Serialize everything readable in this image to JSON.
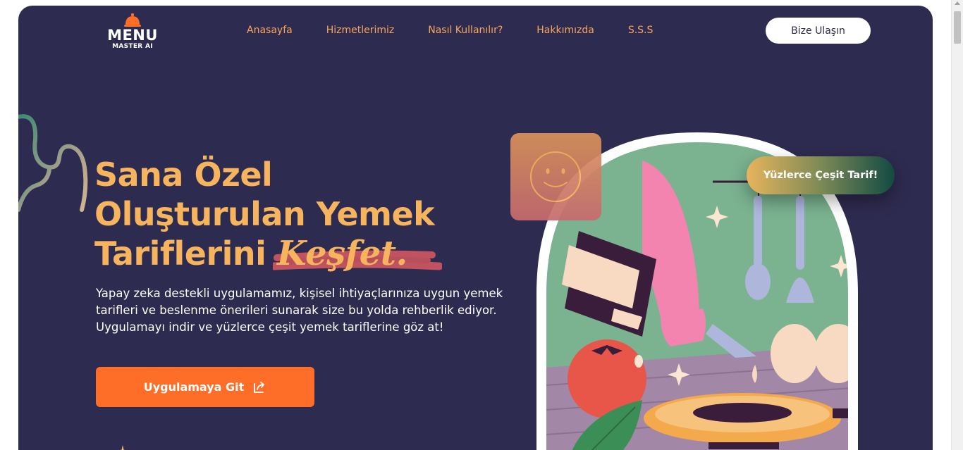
{
  "brand": {
    "name": "MENU",
    "tagline": "MASTER AI"
  },
  "nav": {
    "items": [
      {
        "label": "Anasayfa"
      },
      {
        "label": "Hizmetlerimiz"
      },
      {
        "label": "Nasıl Kullanılır?"
      },
      {
        "label": "Hakkımızda"
      },
      {
        "label": "S.S.S"
      }
    ],
    "contact_label": "Bize Ulaşın"
  },
  "hero": {
    "headline_line1": "Sana Özel",
    "headline_line2": "Oluşturulan Yemek",
    "headline_line3": "Tariflerini",
    "headline_highlight": "Keşfet.",
    "description": "Yapay zeka destekli uygulamamız, kişisel ihtiyaçlarınıza uygun yemek tarifleri ve beslenme önerileri sunarak size bu yolda rehberlik ediyor. Uygulamayı indir ve yüzlerce çeşit yemek tariflerine göz at!",
    "cta_label": "Uygulamaya Git",
    "badge_label": "Yüzlerce Çeşit Tarif!"
  },
  "icons": [
    "cloche-icon",
    "external-link-icon",
    "smiley-icon",
    "sparkle-icon"
  ],
  "colors": {
    "background": "#2e2b50",
    "accent_orange": "#fe6e28",
    "headline_gold": "#f7b45e",
    "nav_text": "#f8a65a",
    "brush_red": "#c0535f"
  }
}
